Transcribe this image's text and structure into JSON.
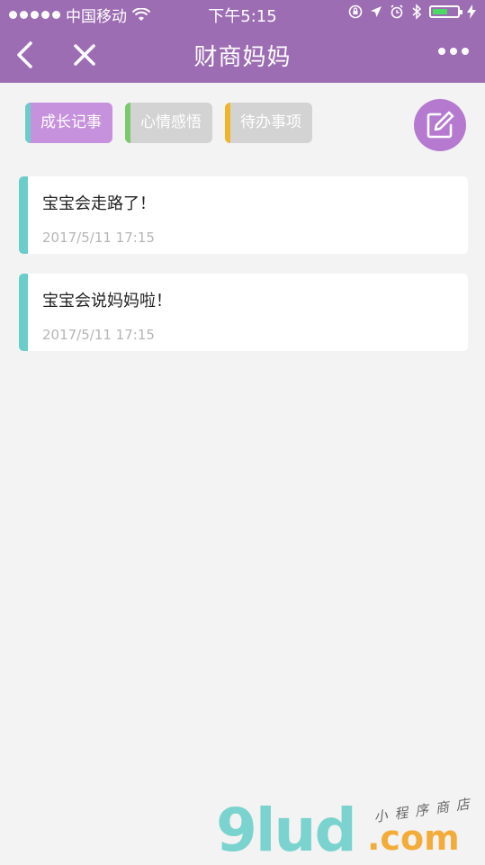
{
  "status": {
    "carrier": "中国移动",
    "time": "下午5:15"
  },
  "nav": {
    "title": "财商妈妈"
  },
  "tabs": [
    {
      "label": "成长记事",
      "stripe_color": "#6bcdc9",
      "active": true
    },
    {
      "label": "心情感悟",
      "stripe_color": "#7ac96b",
      "active": false
    },
    {
      "label": "待办事项",
      "stripe_color": "#f0b429",
      "active": false
    }
  ],
  "entries": [
    {
      "text": "宝宝会走路了！",
      "date": "2017/5/11 17:15"
    },
    {
      "text": "宝宝会说妈妈啦！",
      "date": "2017/5/11 17:15"
    }
  ],
  "watermark": {
    "logo": "9lud",
    "domain": ".com",
    "tagline": "小程序商店"
  },
  "colors": {
    "header": "#9d6db3",
    "active_tab": "#c792dd",
    "inactive_tab": "#d3d3d3",
    "entry_bar": "#6bcdc9"
  }
}
